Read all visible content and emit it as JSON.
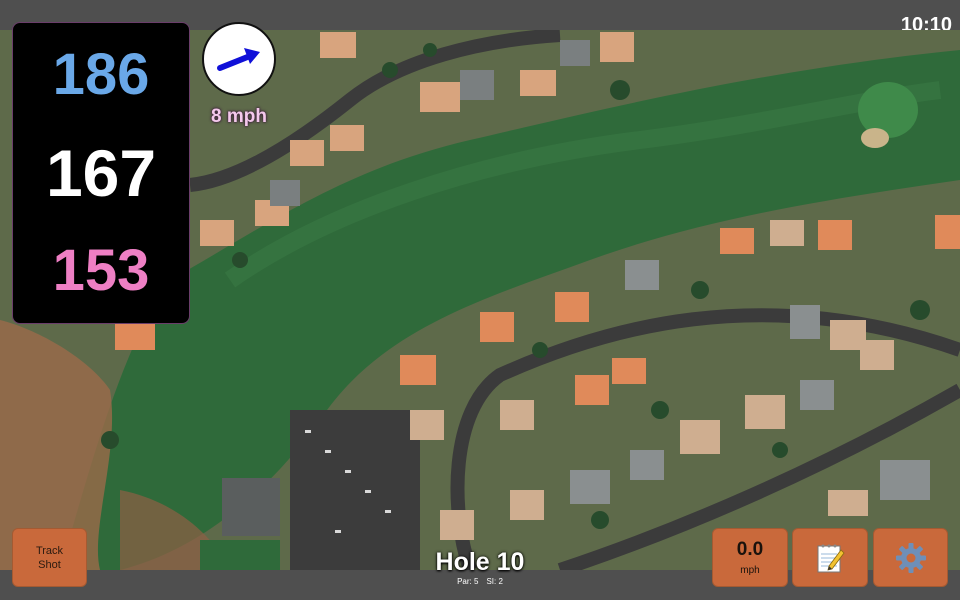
{
  "status_bar": {
    "time": "10:10"
  },
  "distances": {
    "back": "186",
    "middle": "167",
    "front": "153",
    "colors": {
      "back": "#6aa8e8",
      "middle": "#ffffff",
      "front": "#ee7fc4"
    }
  },
  "wind": {
    "indicator_icon": "wind-direction-arrow-icon",
    "speed_label": "8 mph",
    "button_value": "0.0",
    "button_unit": "mph"
  },
  "buttons": {
    "track_shot_line1": "Track",
    "track_shot_line2": "Shot",
    "notes_icon": "notepad-icon",
    "settings_icon": "gear-icon",
    "accent_color": "#c9693b"
  },
  "hole": {
    "title": "Hole 10",
    "par": "Par: 5",
    "stroke_index": "SI: 2"
  },
  "map": {
    "type": "satellite-aerial"
  }
}
